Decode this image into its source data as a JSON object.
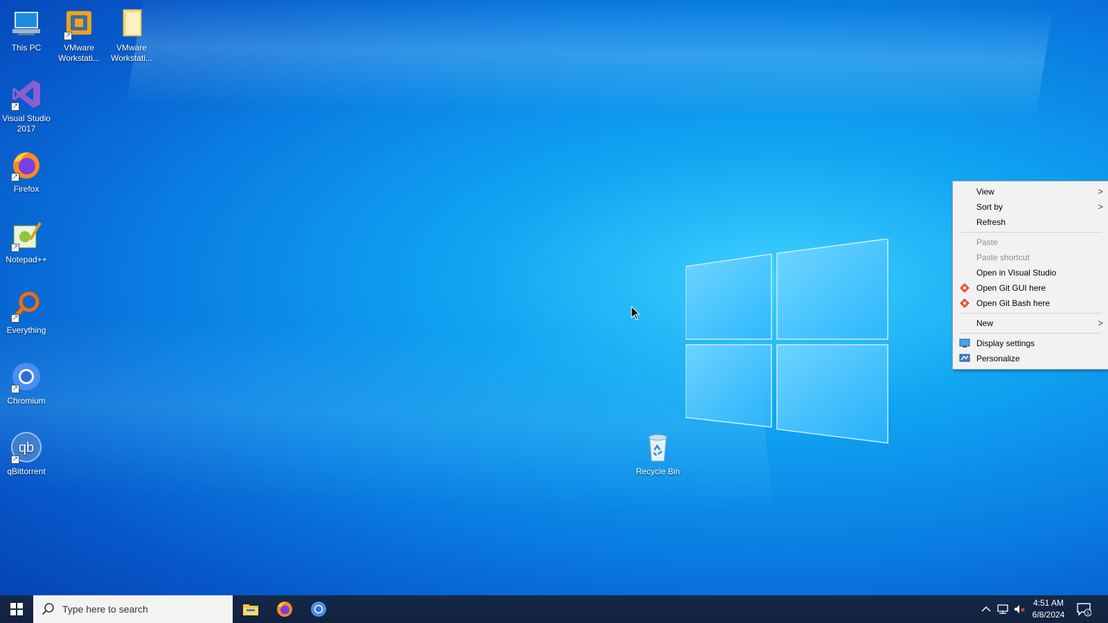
{
  "desktop": {
    "icons": [
      {
        "label": "This PC",
        "icon": "this-pc-icon"
      },
      {
        "label": "VMware Workstati...",
        "icon": "vmware-workstation-icon"
      },
      {
        "label": "VMware Workstati...",
        "icon": "folder-icon"
      },
      {
        "label": "Visual Studio 2017",
        "icon": "visual-studio-icon"
      },
      {
        "label": "Firefox",
        "icon": "firefox-icon"
      },
      {
        "label": "Notepad++",
        "icon": "notepadpp-icon"
      },
      {
        "label": "Everything",
        "icon": "everything-search-icon"
      },
      {
        "label": "Chromium",
        "icon": "chromium-icon"
      },
      {
        "label": "qBittorrent",
        "icon": "qbittorrent-icon"
      },
      {
        "label": "Recycle Bin",
        "icon": "recycle-bin-icon"
      }
    ]
  },
  "context_menu": {
    "view": "View",
    "sort_by": "Sort by",
    "refresh": "Refresh",
    "paste": "Paste",
    "paste_shortcut": "Paste shortcut",
    "open_in_vs": "Open in Visual Studio",
    "open_git_gui": "Open Git GUI here",
    "open_git_bash": "Open Git Bash here",
    "new": "New",
    "display_settings": "Display settings",
    "personalize": "Personalize",
    "submenu_arrow": ">"
  },
  "taskbar": {
    "search_placeholder": "Type here to search",
    "pinned": [
      "file-explorer-icon",
      "firefox-icon",
      "chromium-icon"
    ],
    "time": "4:51 AM",
    "date": "6/8/2024",
    "notification_count": "1"
  },
  "colors": {
    "accent": "#0078d7",
    "taskbar": "#12223e",
    "menu_bg": "#f2f2f2"
  }
}
